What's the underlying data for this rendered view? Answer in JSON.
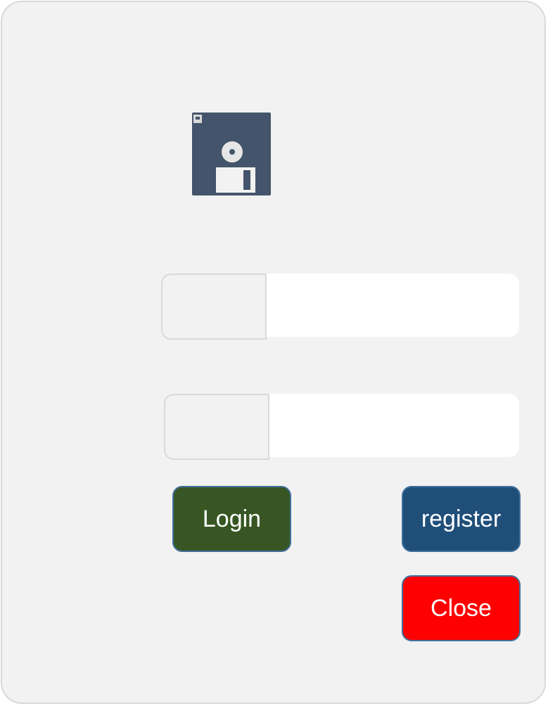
{
  "form": {
    "icon": "floppy-disk-icon",
    "username": {
      "label": "",
      "value": "",
      "placeholder": ""
    },
    "password": {
      "label": "",
      "value": "",
      "placeholder": ""
    }
  },
  "buttons": {
    "login_label": "Login",
    "register_label": "register",
    "close_label": "Close"
  },
  "colors": {
    "background": "#f2f2f2",
    "border": "#d9d9d9",
    "icon": "#44546a",
    "login": "#375623",
    "register": "#1f4e79",
    "close": "#ff0000",
    "button_text": "#ffffff"
  }
}
